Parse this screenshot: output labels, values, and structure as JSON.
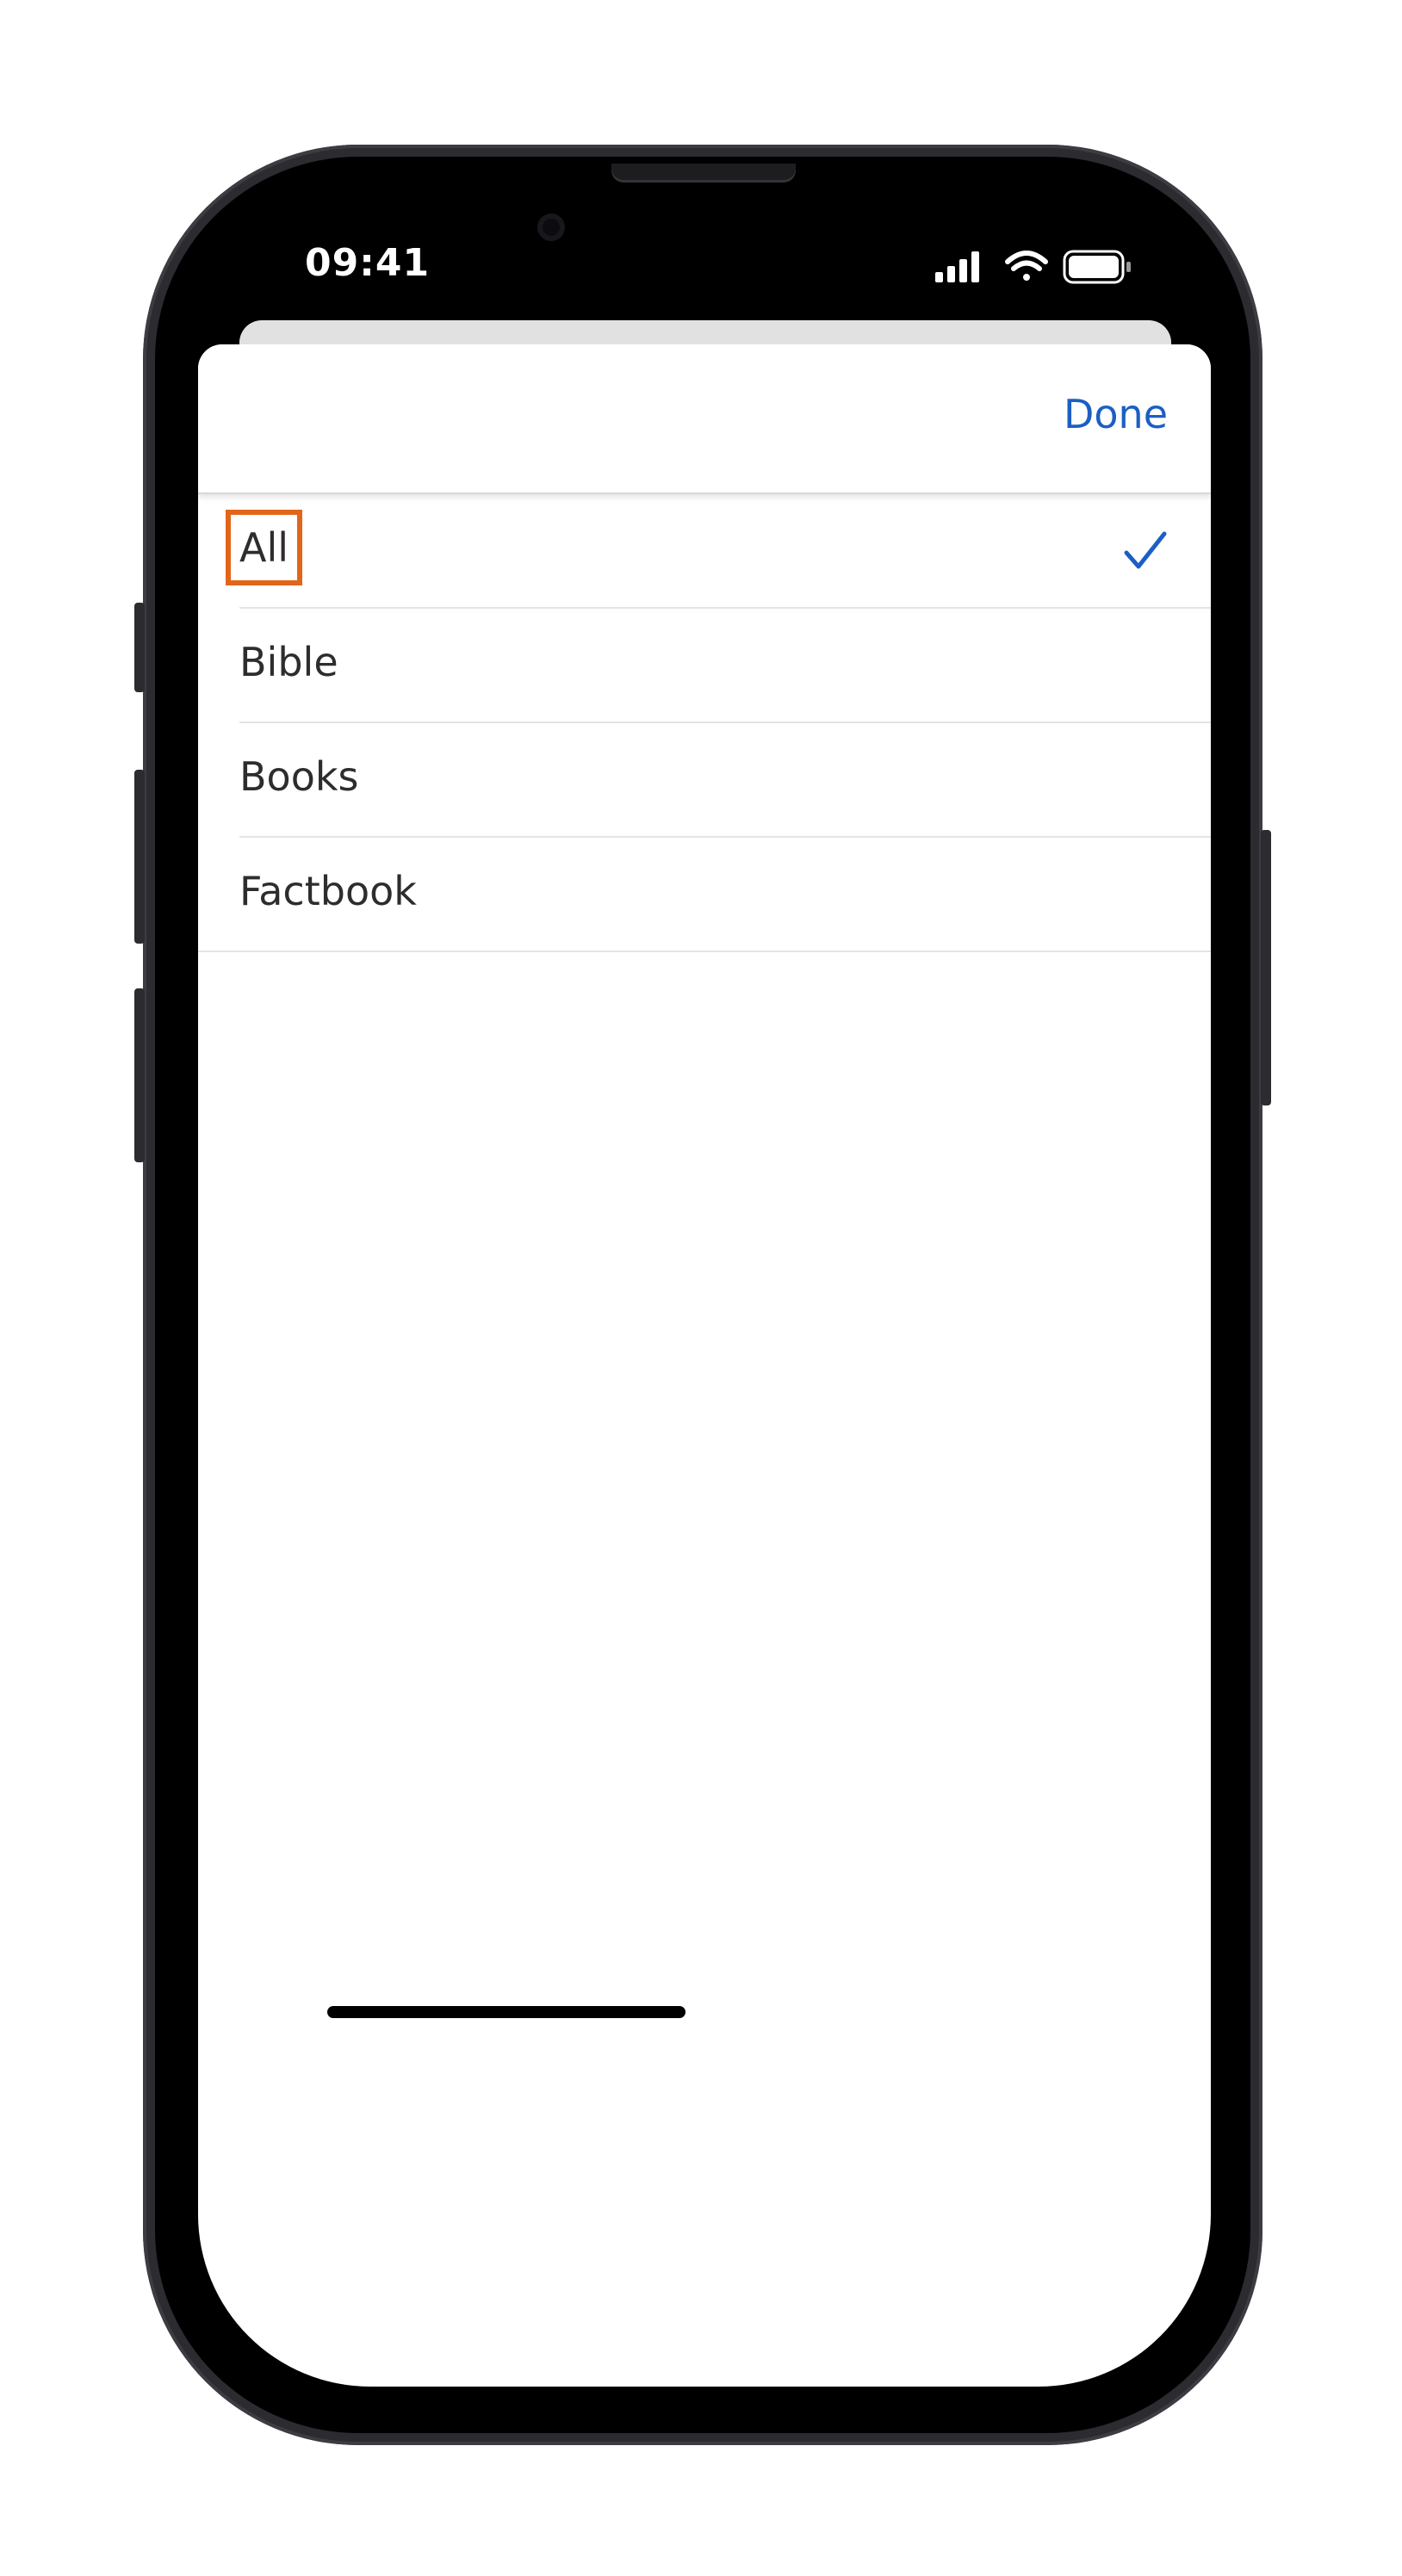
{
  "status_bar": {
    "time": "09:41",
    "icons": [
      "cellular-signal-icon",
      "wifi-icon",
      "battery-icon"
    ]
  },
  "header": {
    "done_label": "Done"
  },
  "options": [
    {
      "label": "All",
      "selected": true
    },
    {
      "label": "Bible",
      "selected": false
    },
    {
      "label": "Books",
      "selected": false
    },
    {
      "label": "Factbook",
      "selected": false
    }
  ],
  "colors": {
    "accent": "#1c5fc4",
    "highlight": "#e2661a",
    "text": "#2d2d2d"
  }
}
